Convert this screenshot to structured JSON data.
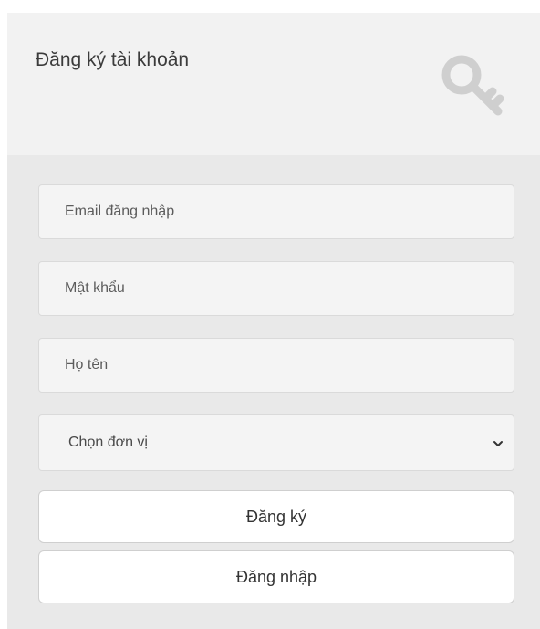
{
  "form": {
    "title": "Đăng ký tài khoản",
    "header_icon": "key-icon",
    "email_placeholder": "Email đăng nhập",
    "password_placeholder": "Mật khẩu",
    "fullname_placeholder": "Họ tên",
    "unit_select_value": "Chọn đơn vị",
    "register_label": "Đăng ký",
    "login_label": "Đăng nhập"
  },
  "colors": {
    "header_bg": "#f2f2f2",
    "body_bg": "#e9e9e9",
    "key_icon": "#cfcfcf"
  }
}
